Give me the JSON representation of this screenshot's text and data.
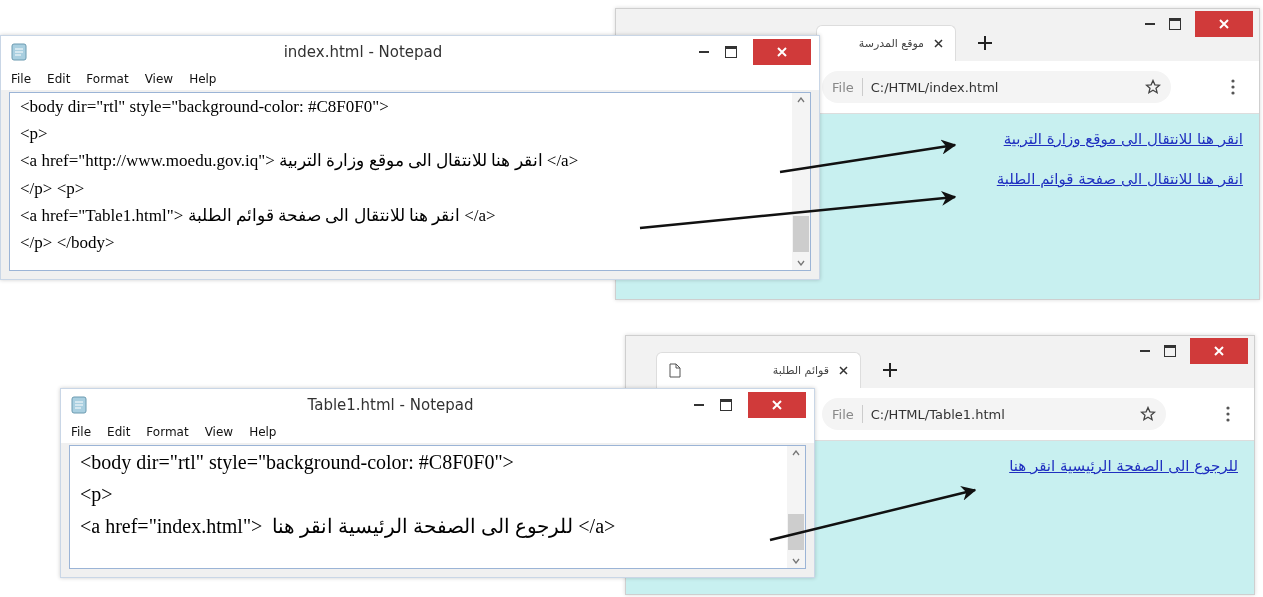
{
  "scenes": [
    {
      "notepad": {
        "title": "index.html - Notepad",
        "menu": [
          "File",
          "Edit",
          "Format",
          "View",
          "Help"
        ],
        "lines": [
          "<body dir=\"rtl\" style=\"background-color: #C8F0F0\">",
          "<p>",
          "<a href=\"http://www.moedu.gov.iq\"> انقر هنا للانتقال الى موقع وزارة التربية </a>",
          "</p> <p>",
          "<a href=\"Table1.html\"> انقر هنا للانتقال الى صفحة قوائم الطلبة </a>",
          "</p> </body>"
        ]
      },
      "browser": {
        "tab": "موقع المدرسة",
        "address_label": "File",
        "url": "C:/HTML/index.html",
        "links": [
          "انقر هنا للانتقال الى موقع وزارة التربية",
          "انقر هنا للانتقال الى صفحة قوائم الطلبة"
        ]
      }
    },
    {
      "notepad": {
        "title": "Table1.html - Notepad",
        "menu": [
          "File",
          "Edit",
          "Format",
          "View",
          "Help"
        ],
        "lines": [
          "<body dir=\"rtl\" style=\"background-color: #C8F0F0\">",
          "<p>",
          "<a href=\"index.html\">  للرجوع الى الصفحة الرئيسية انقر هنا </a>"
        ]
      },
      "browser": {
        "tab": "قوائم الطلبة",
        "address_label": "File",
        "url": "C:/HTML/Table1.html",
        "links": [
          "للرجوع الى الصفحة الرئيسية انقر هنا"
        ]
      }
    }
  ]
}
